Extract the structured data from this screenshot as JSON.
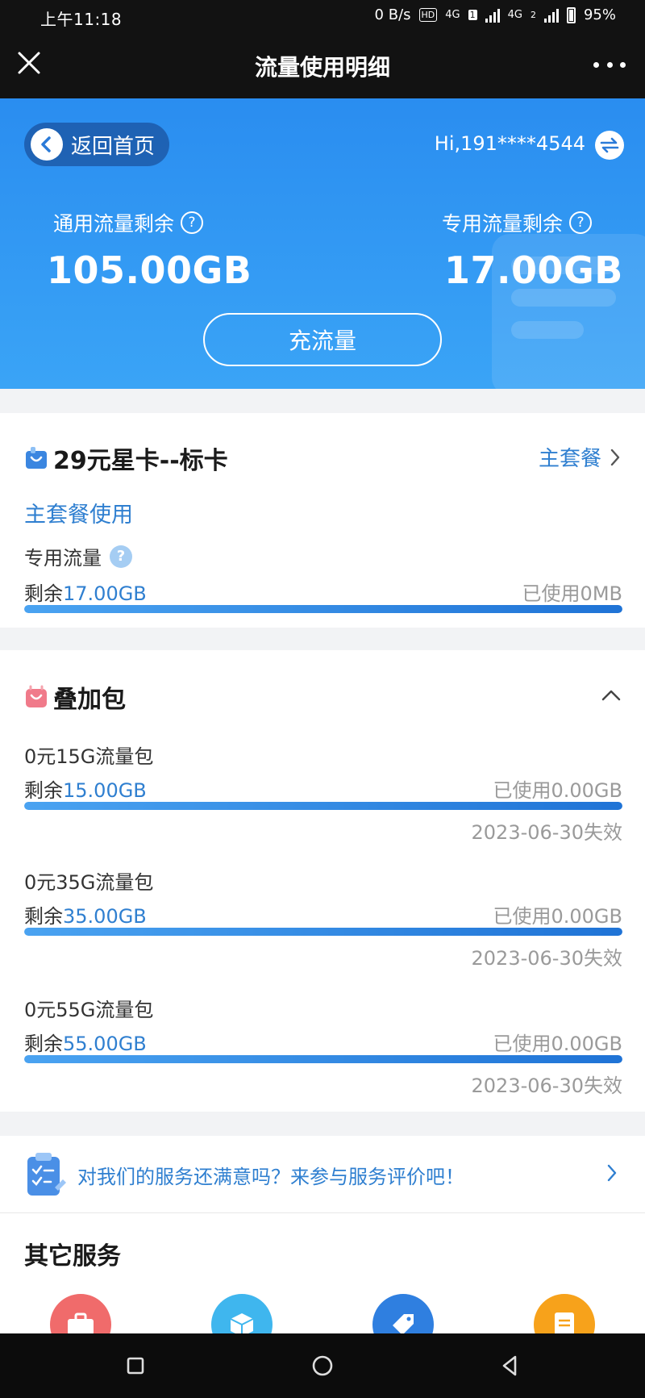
{
  "status_bar": {
    "time": "上午11:18",
    "net_speed": "0 B/s",
    "hd_label": "HD",
    "net1": "4G",
    "sim1": "1",
    "net2": "4G",
    "sim2": "2",
    "battery": "95%"
  },
  "nav": {
    "title": "流量使用明细"
  },
  "header": {
    "back_label": "返回首页",
    "greeting": "Hi,191****4544",
    "general_label": "通用流量剩余",
    "general_value": "105.00GB",
    "special_label": "专用流量剩余",
    "special_value": "17.00GB",
    "recharge_label": "充流量"
  },
  "plan": {
    "name": "29元星卡--标卡",
    "link_label": "主套餐",
    "section_label": "主套餐使用",
    "items": [
      {
        "label": "专用流量",
        "remain_prefix": "剩余",
        "remain_value": "17.00GB",
        "used": "已使用0MB",
        "remaining_fraction": 1.0
      }
    ]
  },
  "addon": {
    "title": "叠加包",
    "items": [
      {
        "name": "0元15G流量包",
        "remain_prefix": "剩余",
        "remain_value": "15.00GB",
        "used": "已使用0.00GB",
        "expire": "2023-06-30失效",
        "remaining_fraction": 1.0
      },
      {
        "name": "0元35G流量包",
        "remain_prefix": "剩余",
        "remain_value": "35.00GB",
        "used": "已使用0.00GB",
        "expire": "2023-06-30失效",
        "remaining_fraction": 1.0
      },
      {
        "name": "0元55G流量包",
        "remain_prefix": "剩余",
        "remain_value": "55.00GB",
        "used": "已使用0.00GB",
        "expire": "2023-06-30失效",
        "remaining_fraction": 1.0
      }
    ]
  },
  "survey": {
    "text": "对我们的服务还满意吗？来参与服务评价吧！"
  },
  "other_services": {
    "title": "其它服务",
    "icons": [
      {
        "icon": "briefcase-icon",
        "color": "#f06b6b"
      },
      {
        "icon": "box-icon",
        "color": "#3fb6ee"
      },
      {
        "icon": "tag-icon",
        "color": "#2f7fe0"
      },
      {
        "icon": "document-icon",
        "color": "#f7a21b"
      }
    ]
  },
  "colors": {
    "accent_blue": "#2f7fd0",
    "hero_blue": "#2a8df0",
    "addon_icon": "#f07a8a"
  }
}
